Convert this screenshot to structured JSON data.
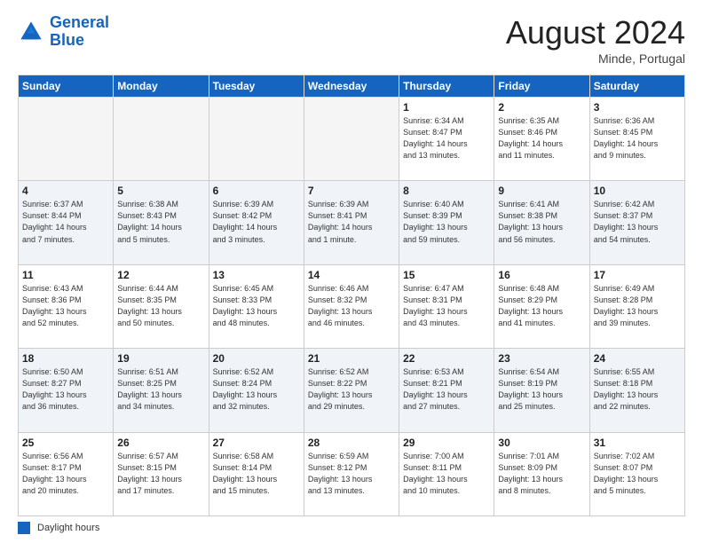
{
  "header": {
    "logo_line1": "General",
    "logo_line2": "Blue",
    "month_title": "August 2024",
    "location": "Minde, Portugal"
  },
  "legend": {
    "label": "Daylight hours"
  },
  "days_of_week": [
    "Sunday",
    "Monday",
    "Tuesday",
    "Wednesday",
    "Thursday",
    "Friday",
    "Saturday"
  ],
  "weeks": [
    [
      {
        "day": "",
        "info": ""
      },
      {
        "day": "",
        "info": ""
      },
      {
        "day": "",
        "info": ""
      },
      {
        "day": "",
        "info": ""
      },
      {
        "day": "1",
        "info": "Sunrise: 6:34 AM\nSunset: 8:47 PM\nDaylight: 14 hours\nand 13 minutes."
      },
      {
        "day": "2",
        "info": "Sunrise: 6:35 AM\nSunset: 8:46 PM\nDaylight: 14 hours\nand 11 minutes."
      },
      {
        "day": "3",
        "info": "Sunrise: 6:36 AM\nSunset: 8:45 PM\nDaylight: 14 hours\nand 9 minutes."
      }
    ],
    [
      {
        "day": "4",
        "info": "Sunrise: 6:37 AM\nSunset: 8:44 PM\nDaylight: 14 hours\nand 7 minutes."
      },
      {
        "day": "5",
        "info": "Sunrise: 6:38 AM\nSunset: 8:43 PM\nDaylight: 14 hours\nand 5 minutes."
      },
      {
        "day": "6",
        "info": "Sunrise: 6:39 AM\nSunset: 8:42 PM\nDaylight: 14 hours\nand 3 minutes."
      },
      {
        "day": "7",
        "info": "Sunrise: 6:39 AM\nSunset: 8:41 PM\nDaylight: 14 hours\nand 1 minute."
      },
      {
        "day": "8",
        "info": "Sunrise: 6:40 AM\nSunset: 8:39 PM\nDaylight: 13 hours\nand 59 minutes."
      },
      {
        "day": "9",
        "info": "Sunrise: 6:41 AM\nSunset: 8:38 PM\nDaylight: 13 hours\nand 56 minutes."
      },
      {
        "day": "10",
        "info": "Sunrise: 6:42 AM\nSunset: 8:37 PM\nDaylight: 13 hours\nand 54 minutes."
      }
    ],
    [
      {
        "day": "11",
        "info": "Sunrise: 6:43 AM\nSunset: 8:36 PM\nDaylight: 13 hours\nand 52 minutes."
      },
      {
        "day": "12",
        "info": "Sunrise: 6:44 AM\nSunset: 8:35 PM\nDaylight: 13 hours\nand 50 minutes."
      },
      {
        "day": "13",
        "info": "Sunrise: 6:45 AM\nSunset: 8:33 PM\nDaylight: 13 hours\nand 48 minutes."
      },
      {
        "day": "14",
        "info": "Sunrise: 6:46 AM\nSunset: 8:32 PM\nDaylight: 13 hours\nand 46 minutes."
      },
      {
        "day": "15",
        "info": "Sunrise: 6:47 AM\nSunset: 8:31 PM\nDaylight: 13 hours\nand 43 minutes."
      },
      {
        "day": "16",
        "info": "Sunrise: 6:48 AM\nSunset: 8:29 PM\nDaylight: 13 hours\nand 41 minutes."
      },
      {
        "day": "17",
        "info": "Sunrise: 6:49 AM\nSunset: 8:28 PM\nDaylight: 13 hours\nand 39 minutes."
      }
    ],
    [
      {
        "day": "18",
        "info": "Sunrise: 6:50 AM\nSunset: 8:27 PM\nDaylight: 13 hours\nand 36 minutes."
      },
      {
        "day": "19",
        "info": "Sunrise: 6:51 AM\nSunset: 8:25 PM\nDaylight: 13 hours\nand 34 minutes."
      },
      {
        "day": "20",
        "info": "Sunrise: 6:52 AM\nSunset: 8:24 PM\nDaylight: 13 hours\nand 32 minutes."
      },
      {
        "day": "21",
        "info": "Sunrise: 6:52 AM\nSunset: 8:22 PM\nDaylight: 13 hours\nand 29 minutes."
      },
      {
        "day": "22",
        "info": "Sunrise: 6:53 AM\nSunset: 8:21 PM\nDaylight: 13 hours\nand 27 minutes."
      },
      {
        "day": "23",
        "info": "Sunrise: 6:54 AM\nSunset: 8:19 PM\nDaylight: 13 hours\nand 25 minutes."
      },
      {
        "day": "24",
        "info": "Sunrise: 6:55 AM\nSunset: 8:18 PM\nDaylight: 13 hours\nand 22 minutes."
      }
    ],
    [
      {
        "day": "25",
        "info": "Sunrise: 6:56 AM\nSunset: 8:17 PM\nDaylight: 13 hours\nand 20 minutes."
      },
      {
        "day": "26",
        "info": "Sunrise: 6:57 AM\nSunset: 8:15 PM\nDaylight: 13 hours\nand 17 minutes."
      },
      {
        "day": "27",
        "info": "Sunrise: 6:58 AM\nSunset: 8:14 PM\nDaylight: 13 hours\nand 15 minutes."
      },
      {
        "day": "28",
        "info": "Sunrise: 6:59 AM\nSunset: 8:12 PM\nDaylight: 13 hours\nand 13 minutes."
      },
      {
        "day": "29",
        "info": "Sunrise: 7:00 AM\nSunset: 8:11 PM\nDaylight: 13 hours\nand 10 minutes."
      },
      {
        "day": "30",
        "info": "Sunrise: 7:01 AM\nSunset: 8:09 PM\nDaylight: 13 hours\nand 8 minutes."
      },
      {
        "day": "31",
        "info": "Sunrise: 7:02 AM\nSunset: 8:07 PM\nDaylight: 13 hours\nand 5 minutes."
      }
    ]
  ]
}
